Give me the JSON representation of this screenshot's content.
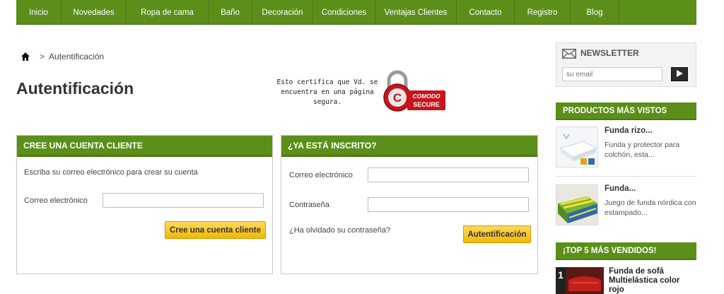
{
  "nav": {
    "items": [
      {
        "label": "Inicio"
      },
      {
        "label": "Novedades"
      },
      {
        "label": "Ropa de cama"
      },
      {
        "label": "Baño"
      },
      {
        "label": "Decoración"
      },
      {
        "label": "Condiciones"
      },
      {
        "label": "Ventajas Clientes"
      },
      {
        "label": "Contacto"
      },
      {
        "label": "Registro"
      },
      {
        "label": "Blog"
      }
    ]
  },
  "breadcrumb": {
    "separator": ">",
    "current": "Autentificación"
  },
  "page_title": "Autentificación",
  "secure": {
    "text": "Esto certifica que Vd. se encuentra en una página segura.",
    "badge_top": "COMODO",
    "badge_bottom": "SECURE"
  },
  "create_account": {
    "header": "CREE UNA CUENTA CLIENTE",
    "intro": "Escriba su correo electrónico para crear su cuenta",
    "email_label": "Correo electrónico",
    "email_value": "",
    "button": "Cree una cuenta cliente"
  },
  "login": {
    "header": "¿YA ESTÁ INSCRITO?",
    "email_label": "Correo electrónico",
    "email_value": "",
    "password_label": "Contraseña",
    "password_value": "",
    "forgot": "¿Ha olvidado su contraseña?",
    "button": "Autentificación"
  },
  "newsletter": {
    "title": "NEWSLETTER",
    "placeholder": "su email"
  },
  "most_viewed": {
    "header": "PRODUCTOS MÁS VISTOS",
    "items": [
      {
        "title": "Funda rizo...",
        "desc": "Funda y protector para colchón, esta..."
      },
      {
        "title": "Funda...",
        "desc": "Juego de funda nórdica con estampado..."
      }
    ]
  },
  "top5": {
    "header": "¡TOP 5 MÁS VENDIDOS!",
    "items": [
      {
        "rank": "1",
        "title": "Funda de sofá Multielástica color rojo"
      }
    ]
  },
  "colors": {
    "green": "#5b8f1a",
    "yellow_button": "#f2b705"
  }
}
